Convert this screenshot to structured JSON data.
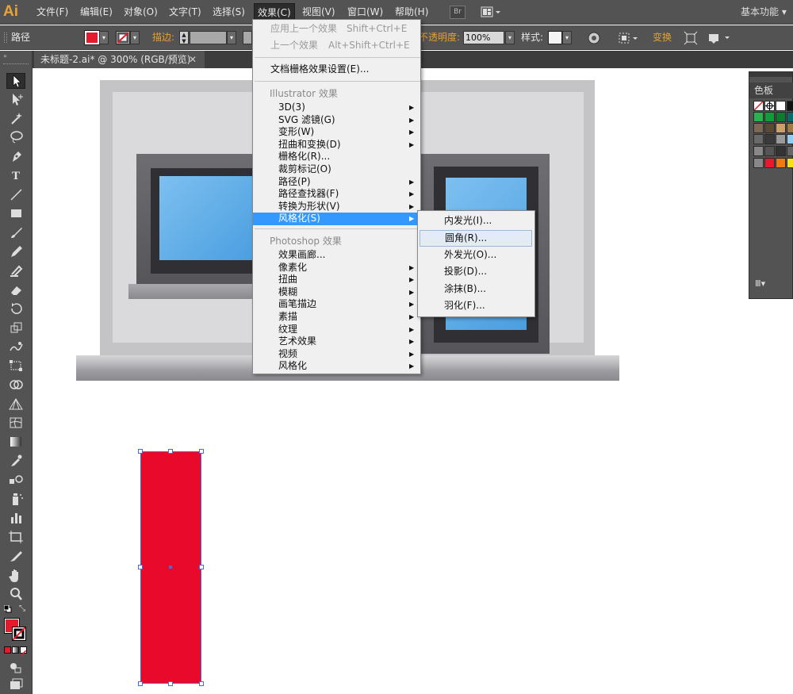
{
  "app": {
    "logo": "Ai",
    "workspace": "基本功能 ▾"
  },
  "menubar": {
    "items": [
      "文件(F)",
      "编辑(E)",
      "对象(O)",
      "文字(T)",
      "选择(S)",
      "效果(C)",
      "视图(V)",
      "窗口(W)",
      "帮助(H)"
    ],
    "bridge": "Br"
  },
  "control_bar": {
    "selection_type": "路径",
    "stroke_label": "描边:",
    "opacity_label": "不透明度:",
    "opacity_value": "100%",
    "style_label": "样式:",
    "transform_label": "变换",
    "fill_color": "#e8192c"
  },
  "document_tab": {
    "title": "未标题-2.ai* @ 300% (RGB/预览)",
    "close": "✕"
  },
  "swatches_panel": {
    "title": "色板",
    "footer": "Ⅲ▾"
  },
  "effect_menu": {
    "apply_last": {
      "label": "应用上一个效果",
      "shortcut": "Shift+Ctrl+E"
    },
    "last_effect": {
      "label": "上一个效果",
      "shortcut": "Alt+Shift+Ctrl+E"
    },
    "raster_settings": "文档栅格效果设置(E)...",
    "illustrator_header": "Illustrator 效果",
    "illustrator_items": [
      "3D(3)",
      "SVG 滤镜(G)",
      "变形(W)",
      "扭曲和变换(D)",
      "栅格化(R)...",
      "裁剪标记(O)",
      "路径(P)",
      "路径查找器(F)",
      "转换为形状(V)",
      "风格化(S)"
    ],
    "photoshop_header": "Photoshop 效果",
    "photoshop_items": [
      "效果画廊...",
      "像素化",
      "扭曲",
      "模糊",
      "画笔描边",
      "素描",
      "纹理",
      "艺术效果",
      "视频",
      "风格化"
    ]
  },
  "stylize_submenu": {
    "items": [
      "内发光(I)...",
      "圆角(R)...",
      "外发光(O)...",
      "投影(D)...",
      "涂抹(B)...",
      "羽化(F)..."
    ]
  },
  "colors": {
    "selection": "#3399ff",
    "accent": "#e6a030",
    "red_fill": "#e8092b"
  }
}
